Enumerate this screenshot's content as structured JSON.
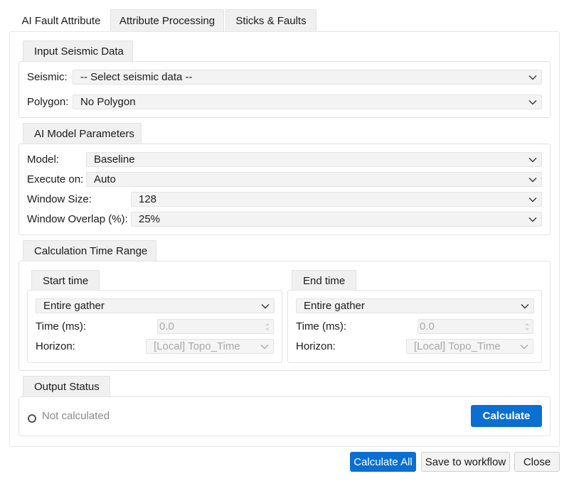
{
  "tabs": [
    {
      "label": "AI Fault Attribute",
      "active": true
    },
    {
      "label": "Attribute Processing",
      "active": false
    },
    {
      "label": "Sticks & Faults",
      "active": false
    }
  ],
  "input_seismic": {
    "title": "Input Seismic Data",
    "seismic_label": "Seismic:",
    "seismic_value": "-- Select seismic data --",
    "polygon_label": "Polygon:",
    "polygon_value": "No Polygon"
  },
  "model_params": {
    "title": "AI Model Parameters",
    "model_label": "Model:",
    "model_value": "Baseline",
    "execute_label": "Execute on:",
    "execute_value": "Auto",
    "window_size_label": "Window Size:",
    "window_size_value": "128",
    "window_overlap_label": "Window Overlap (%):",
    "window_overlap_value": "25%"
  },
  "time_range": {
    "title": "Calculation Time Range",
    "start": {
      "title": "Start time",
      "mode_value": "Entire gather",
      "time_label": "Time (ms):",
      "time_value": "0.0",
      "horizon_label": "Horizon:",
      "horizon_value": "[Local] Topo_Time"
    },
    "end": {
      "title": "End time",
      "mode_value": "Entire gather",
      "time_label": "Time (ms):",
      "time_value": "0.0",
      "horizon_label": "Horizon:",
      "horizon_value": "[Local] Topo_Time"
    }
  },
  "output_status": {
    "title": "Output Status",
    "status_text": "Not calculated",
    "calculate_label": "Calculate"
  },
  "footer": {
    "calculate_all_label": "Calculate All",
    "save_label": "Save to workflow",
    "close_label": "Close"
  },
  "colors": {
    "accent": "#0a6fd1",
    "disabled_text": "#a8a8a8"
  }
}
